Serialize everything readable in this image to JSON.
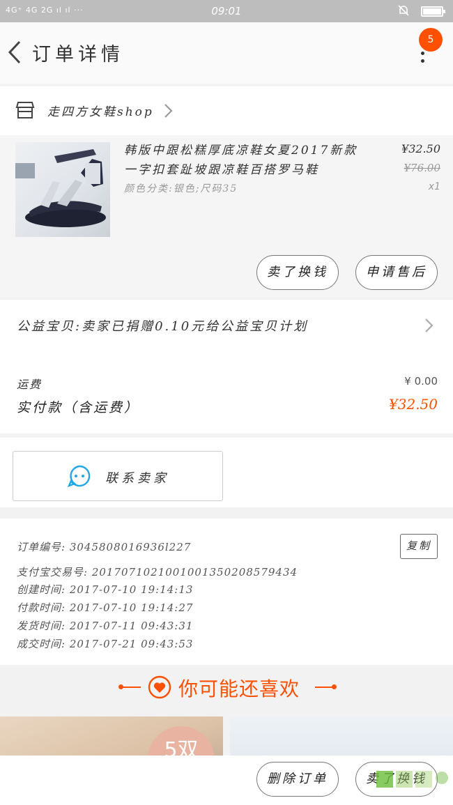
{
  "status_bar": {
    "signal_text": "4G⁺ 4G 2G ıl ıl ···",
    "time": "09:01"
  },
  "header": {
    "back_icon": "chevron-left-icon",
    "title": "订单详情",
    "badge": "5",
    "more_icon": "more-vertical-icon"
  },
  "shop": {
    "icon": "store-icon",
    "name": "走四方女鞋shop"
  },
  "item": {
    "name": "韩版中跟松糕厚底凉鞋女夏2017新款一字扣套趾坡跟凉鞋百搭罗马鞋",
    "spec": "颜色分类:银色;尺码35",
    "price": "¥32.50",
    "original_price": "¥76.00",
    "quantity": "x1",
    "btn_sold": "卖了换钱",
    "btn_service": "申请售后"
  },
  "charity": {
    "text": "公益宝贝:卖家已捐赠0.10元给公益宝贝计划"
  },
  "totals": {
    "shipping_label": "运费",
    "shipping_value": "¥ 0.00",
    "paid_label": "实付款（含运费）",
    "paid_value": "¥32.50"
  },
  "contact": {
    "label": "联系卖家"
  },
  "order_info": {
    "order_no": "订单编号: 3045808016936l227",
    "trade_no": "支付宝交易号: 2017071021001001350208579434",
    "created": "创建时间: 2017-07-10 19:14:13",
    "paid": "付款时间: 2017-07-10 19:14:27",
    "shipped": "发货时间: 2017-07-11 09:43:31",
    "completed": "成交时间: 2017-07-21 09:43:53",
    "copy_label": "复制"
  },
  "recommend": {
    "title": "你可能还喜欢"
  },
  "cards": {
    "tag": "5双"
  },
  "bottom": {
    "btn_delete": "删除订单",
    "btn_sold": "卖了换钱"
  },
  "colors": {
    "accent": "#ff5000",
    "contact_icon": "#1fa7e8"
  }
}
